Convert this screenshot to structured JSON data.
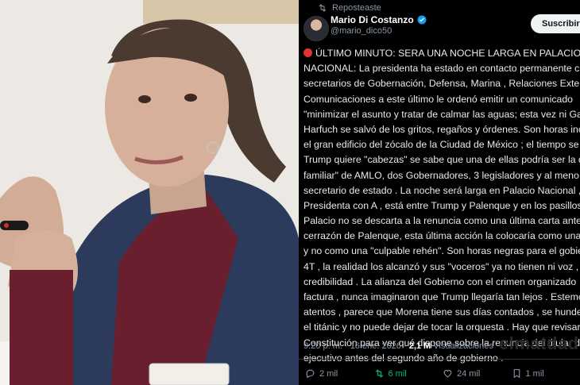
{
  "post": {
    "repost_label": "Reposteaste",
    "author_name": "Mario Di Costanzo",
    "author_handle": "@mario_dico50",
    "subscribe_label": "Suscribirse",
    "lines": [
      "ÚLTIMO MINUTO: SERA UNA NOCHE LARGA EN PALACIO",
      "NACIONAL: La presidenta ha estado en contacto permanente c",
      "secretarios de Gobernación, Defensa, Marina , Relaciones Exte",
      "Comunicaciones a este último le ordenó emitir un comunicado",
      "\"minimizar el asunto y tratar de calmar las aguas; esta vez ni Ga",
      "Harfuch se salvó de los gritos, regaños y órdenes. Son horas inc",
      "el gran edificio del zócalo de la Ciudad de México ; el tiempo se",
      "Trump quiere \"cabezas\" se sabe que una de ellas podría ser la d",
      "familiar\" de AMLO, dos Gobernadores, 3 legisladores y al meno",
      "secretario de estado . La noche será larga en Palacio Nacional ,",
      "Presidenta con A , está entre Trump y Palenque y en los pasillos",
      "Palacio no se descarta a la renuncia como una última carta ante",
      "cerrazón de Palenque, esta última acción la colocaría como una",
      "y no como una \"culpable rehén\". Son horas negras para el gobie",
      "4T , la realidad los alcanzó y sus \"voceros\" ya no tienen ni voz ,",
      "credibilidad . La alianza del Gobierno con el crimen organizado",
      "factura , nunca imaginaron que Trump llegaría tan lejos . Estemo",
      "atentos , parece que Morena tiene sus días contados , se hunde",
      "el titánic y no puede dejar de tocar la orquesta . Hay que revisar",
      "Constitución para ver qué dispone sobre la renuncia del titular d",
      "ejecutivo antes del segundo año de gobierno ."
    ],
    "time": "9:20 p. m. · 16 ene. 2026 ·",
    "views_count": "2,1 M",
    "views_label": "Visualizaciones",
    "watermark": "elmatdad",
    "replies": "2 mil",
    "reposts": "6 mil",
    "likes": "24 mil",
    "bookmarks": "1 mil",
    "colors": {
      "repost_active": "#00ba7c",
      "verified": "#1d9bf0",
      "live_dot": "#e2342f"
    }
  }
}
